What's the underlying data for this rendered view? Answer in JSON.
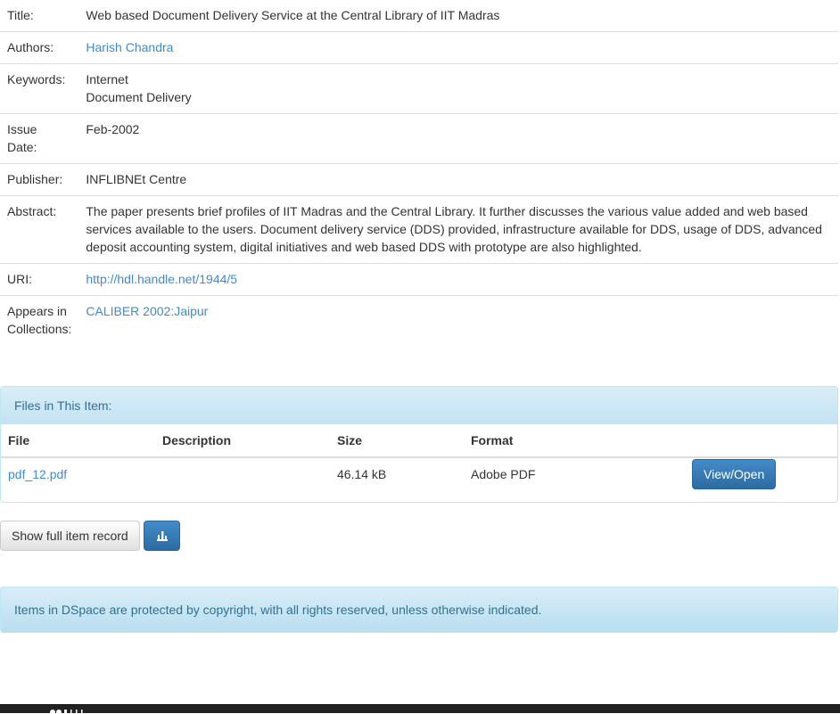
{
  "metadata": {
    "title_label": "Title:",
    "title_value": "Web based Document Delivery Service at the Central Library of IIT Madras",
    "authors_label": "Authors:",
    "authors": [
      "Harish Chandra"
    ],
    "keywords_label": "Keywords:",
    "keywords": [
      "Internet",
      "Document Delivery"
    ],
    "issue_date_label_1": "Issue",
    "issue_date_label_2": "Date:",
    "issue_date_value": "Feb-2002",
    "publisher_label": "Publisher:",
    "publisher_value": "INFLIBNEt Centre",
    "abstract_label": "Abstract:",
    "abstract_value": "The paper presents brief profiles of IIT Madras and the Central Library. It further discusses the various value added and web based services available to the users. Document delivery service (DDS) provided, infrastructure available for DDS, usage of DDS, advanced deposit accounting system, digital initiatives and web based DDS with prototype are also highlighted.",
    "uri_label": "URI:",
    "uri_value": "http://hdl.handle.net/1944/5",
    "collections_label_1": "Appears in",
    "collections_label_2": "Collections:",
    "collections_value": "CALIBER 2002:Jaipur"
  },
  "files": {
    "heading": "Files in This Item:",
    "columns": {
      "file": "File",
      "description": "Description",
      "size": "Size",
      "format": "Format"
    },
    "rows": [
      {
        "file": "pdf_12.pdf",
        "description": "",
        "size": "46.14 kB",
        "format": "Adobe PDF",
        "action": "View/Open"
      }
    ]
  },
  "actions": {
    "show_full_record": "Show full item record",
    "stats_icon": "bar-chart-icon"
  },
  "copyright_notice": "Items in DSpace are protected by copyright, with all rights reserved, unless otherwise indicated.",
  "colors": {
    "link": "#428bca",
    "primary": "#428bca",
    "info_text": "#31708f",
    "info_border": "#bce8f1",
    "footer": "#222222"
  }
}
